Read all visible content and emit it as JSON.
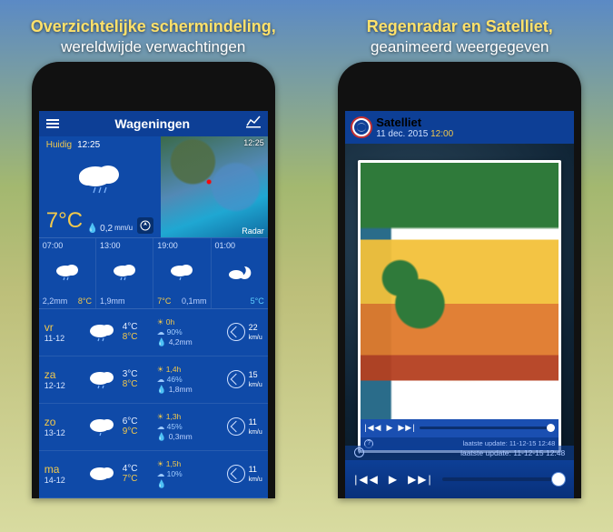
{
  "promos": {
    "left": {
      "line1": "Overzichtelijke schermindeling,",
      "line2": "wereldwijde verwachtingen"
    },
    "right": {
      "line1": "Regenradar en Satelliet,",
      "line2": "geanimeerd weergegeven"
    }
  },
  "screen1": {
    "header": {
      "title": "Wageningen"
    },
    "current": {
      "label": "Huidig",
      "time": "12:25",
      "temp": "7°C",
      "precip": "0,2",
      "precip_unit": "mm/u",
      "radar_time": "12:25",
      "radar_label": "Radar"
    },
    "hours": [
      {
        "time": "07:00",
        "precip": "2,2mm",
        "temp": "8°C",
        "night": false
      },
      {
        "time": "13:00",
        "precip": "1,9mm",
        "temp": "",
        "night": false
      },
      {
        "time": "19:00",
        "precip": "0,1mm",
        "temp": "7°C",
        "night": false
      },
      {
        "time": "01:00",
        "precip": "",
        "temp": "5°C",
        "night": true
      }
    ],
    "days": [
      {
        "dow": "vr",
        "date": "11-12",
        "lo": "4°C",
        "hi": "8°C",
        "sun": "0h",
        "cloud": "90%",
        "rain": "4,2mm",
        "wind": "22",
        "wind_u": "km/u"
      },
      {
        "dow": "za",
        "date": "12-12",
        "lo": "3°C",
        "hi": "8°C",
        "sun": "1,4h",
        "cloud": "46%",
        "rain": "1,8mm",
        "wind": "15",
        "wind_u": "km/u"
      },
      {
        "dow": "zo",
        "date": "13-12",
        "lo": "6°C",
        "hi": "9°C",
        "sun": "1,3h",
        "cloud": "45%",
        "rain": "0,3mm",
        "wind": "11",
        "wind_u": "km/u"
      },
      {
        "dow": "ma",
        "date": "14-12",
        "lo": "4°C",
        "hi": "7°C",
        "sun": "1,5h",
        "cloud": "10%",
        "rain": "",
        "wind": "11",
        "wind_u": "km/u"
      }
    ]
  },
  "screen2": {
    "title": "Satelliet",
    "date": "11 dec. 2015",
    "time": "12:00",
    "inset_update_label": "laatste update:",
    "inset_update_value": "11-12-15 12:48",
    "outer_update_label": "laatste update:",
    "outer_update_value": "11-12-15 12:48",
    "help": "?",
    "controls": {
      "rew": "|◀◀",
      "play": "▶",
      "fwd": "▶▶|"
    }
  }
}
